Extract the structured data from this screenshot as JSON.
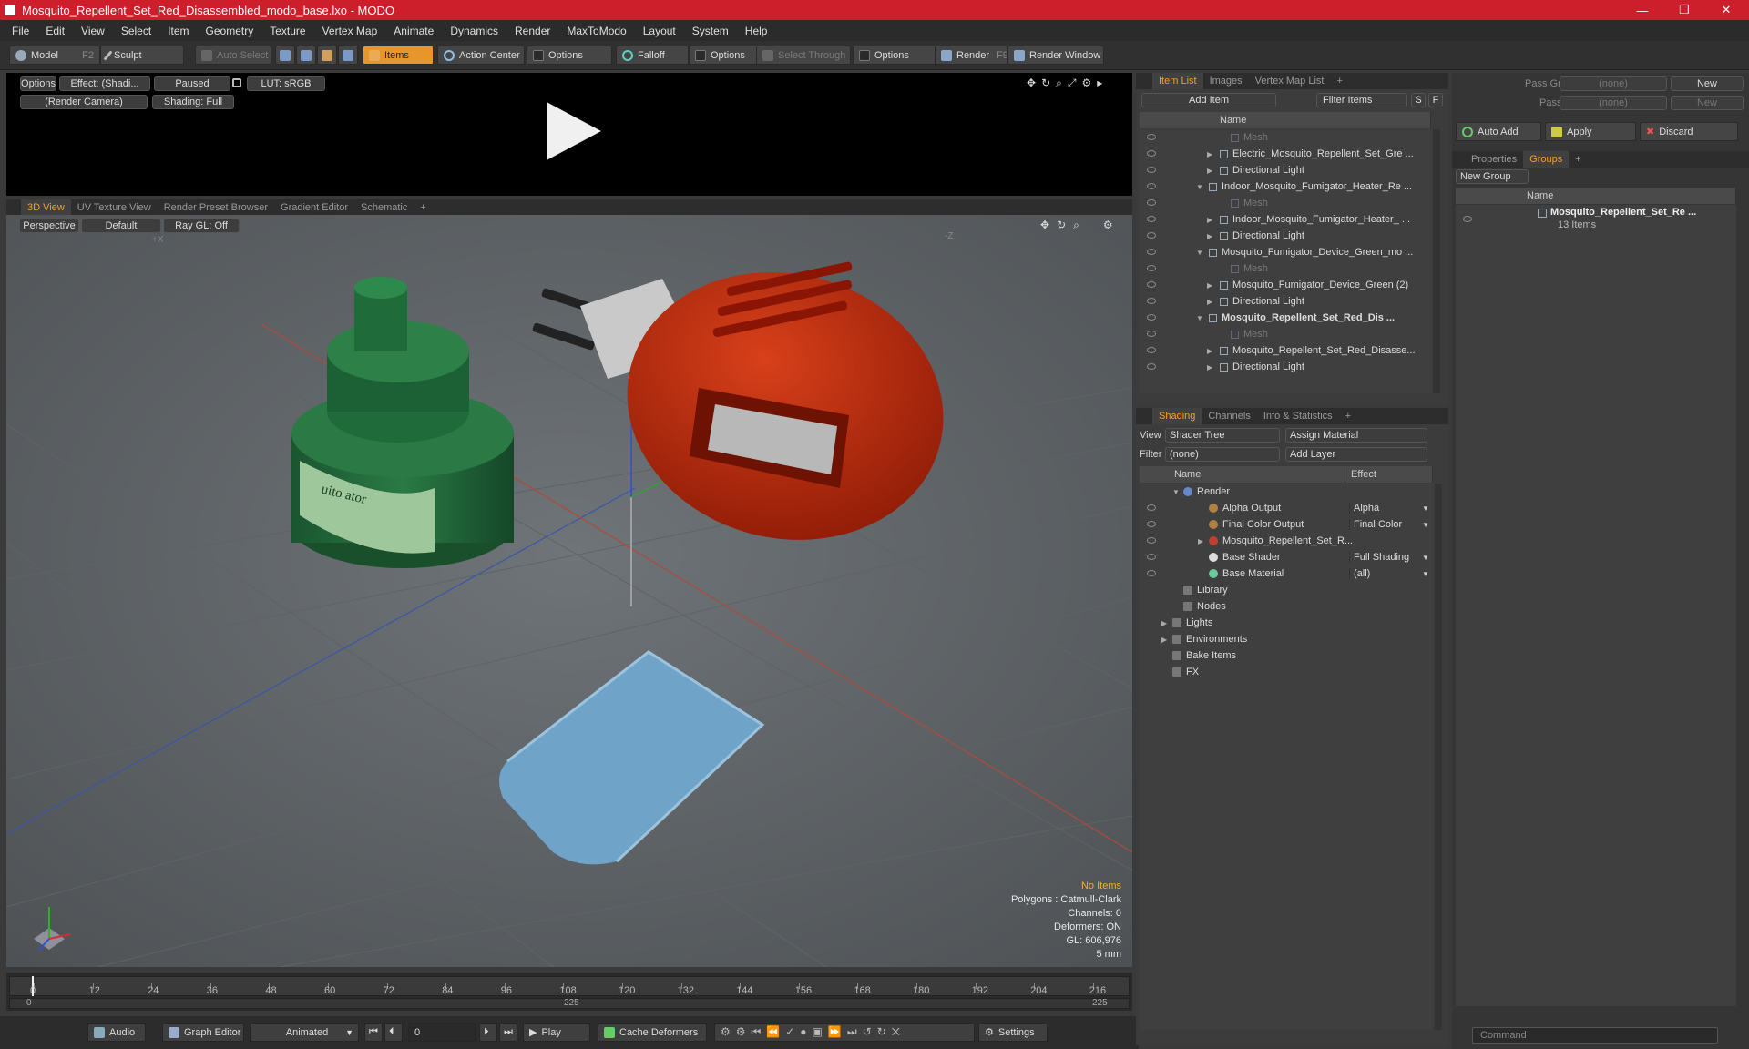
{
  "window": {
    "title": "Mosquito_Repellent_Set_Red_Disassembled_modo_base.lxo - MODO"
  },
  "menu": [
    "File",
    "Edit",
    "View",
    "Select",
    "Item",
    "Geometry",
    "Texture",
    "Vertex Map",
    "Animate",
    "Dynamics",
    "Render",
    "MaxToModo",
    "Layout",
    "System",
    "Help"
  ],
  "toolbar": {
    "model": "Model",
    "model_key": "F2",
    "sculpt": "Sculpt",
    "auto_select": "Auto Select",
    "items": "Items",
    "action_center": "Action Center",
    "options1": "Options",
    "falloff": "Falloff",
    "options2": "Options",
    "select_through": "Select Through",
    "options3": "Options",
    "render": "Render",
    "render_key": "F9",
    "render_window": "Render Window"
  },
  "render_preview": {
    "options": "Options",
    "effect": "Effect: (Shadi...",
    "paused": "Paused",
    "lut": "LUT: sRGB",
    "camera": "(Render Camera)",
    "shading": "Shading: Full"
  },
  "view_tabs": [
    "3D View",
    "UV Texture View",
    "Render Preset Browser",
    "Gradient Editor",
    "Schematic"
  ],
  "viewport": {
    "perspective": "Perspective",
    "default": "Default",
    "raygl": "Ray GL: Off",
    "status": {
      "no_items": "No Items",
      "polygons": "Polygons : Catmull-Clark",
      "channels": "Channels: 0",
      "deformers": "Deformers: ON",
      "gl": "GL: 606,976",
      "unit": "5 mm"
    },
    "label_text": "uito ator"
  },
  "timeline": {
    "ticks": [
      "0",
      "12",
      "24",
      "36",
      "48",
      "60",
      "72",
      "84",
      "96",
      "108",
      "120",
      "132",
      "144",
      "156",
      "168",
      "180",
      "192",
      "204",
      "216"
    ],
    "start": "0",
    "mid": "225",
    "end": "225"
  },
  "bottombar": {
    "audio": "Audio",
    "graph_editor": "Graph Editor",
    "animated": "Animated",
    "frame": "0",
    "play": "Play",
    "cache_deformers": "Cache Deformers",
    "settings": "Settings"
  },
  "item_panel": {
    "tabs": [
      "Item List",
      "Images",
      "Vertex Map List"
    ],
    "add_item": "Add Item",
    "filter_items": "Filter Items",
    "s": "S",
    "f": "F",
    "col_name": "Name",
    "rows": [
      {
        "label": "Mesh",
        "indent": 3,
        "dim": true,
        "bold": false
      },
      {
        "label": "Electric_Mosquito_Repellent_Set_Gre ...",
        "indent": 2,
        "dim": false,
        "bold": false
      },
      {
        "label": "Directional Light",
        "indent": 2,
        "dim": false,
        "bold": false
      },
      {
        "label": "Indoor_Mosquito_Fumigator_Heater_Re ...",
        "indent": 1,
        "dim": false,
        "bold": false
      },
      {
        "label": "Mesh",
        "indent": 3,
        "dim": true,
        "bold": false
      },
      {
        "label": "Indoor_Mosquito_Fumigator_Heater_ ...",
        "indent": 2,
        "dim": false,
        "bold": false
      },
      {
        "label": "Directional Light",
        "indent": 2,
        "dim": false,
        "bold": false
      },
      {
        "label": "Mosquito_Fumigator_Device_Green_mo ...",
        "indent": 1,
        "dim": false,
        "bold": false
      },
      {
        "label": "Mesh",
        "indent": 3,
        "dim": true,
        "bold": false
      },
      {
        "label": "Mosquito_Fumigator_Device_Green (2)",
        "indent": 2,
        "dim": false,
        "bold": false
      },
      {
        "label": "Directional Light",
        "indent": 2,
        "dim": false,
        "bold": false
      },
      {
        "label": "Mosquito_Repellent_Set_Red_Dis ...",
        "indent": 1,
        "dim": false,
        "bold": true
      },
      {
        "label": "Mesh",
        "indent": 3,
        "dim": true,
        "bold": false
      },
      {
        "label": "Mosquito_Repellent_Set_Red_Disasse...",
        "indent": 2,
        "dim": false,
        "bold": false
      },
      {
        "label": "Directional Light",
        "indent": 2,
        "dim": false,
        "bold": false
      }
    ]
  },
  "shading_panel": {
    "tabs": [
      "Shading",
      "Channels",
      "Info & Statistics"
    ],
    "view_label": "View",
    "view_value": "Shader Tree",
    "assign_material": "Assign Material",
    "filter_label": "Filter",
    "filter_value": "(none)",
    "add_layer": "Add Layer",
    "col_name": "Name",
    "col_effect": "Effect",
    "rows": [
      {
        "name": "Render",
        "effect": "",
        "indent": 0
      },
      {
        "name": "Alpha Output",
        "effect": "Alpha",
        "indent": 1
      },
      {
        "name": "Final Color Output",
        "effect": "Final Color",
        "indent": 1
      },
      {
        "name": "Mosquito_Repellent_Set_R...",
        "effect": "",
        "indent": 1
      },
      {
        "name": "Base Shader",
        "effect": "Full Shading",
        "indent": 1
      },
      {
        "name": "Base Material",
        "effect": "(all)",
        "indent": 1
      },
      {
        "name": "Library",
        "effect": "",
        "indent": 0
      },
      {
        "name": "Nodes",
        "effect": "",
        "indent": 0
      },
      {
        "name": "Lights",
        "effect": "",
        "indent": -1
      },
      {
        "name": "Environments",
        "effect": "",
        "indent": -1
      },
      {
        "name": "Bake Items",
        "effect": "",
        "indent": -1
      },
      {
        "name": "FX",
        "effect": "",
        "indent": -1
      }
    ]
  },
  "groups_panel": {
    "pass_groups": "Pass Groups",
    "pass_groups_val": "(none)",
    "new1": "New",
    "passes": "Passes",
    "passes_val": "(none)",
    "new2": "New",
    "auto_add": "Auto Add",
    "apply": "Apply",
    "discard": "Discard",
    "tabs": [
      "Properties",
      "Groups"
    ],
    "new_group": "New Group",
    "col_name": "Name",
    "group_name": "Mosquito_Repellent_Set_Re ...",
    "group_count": "13 Items",
    "command_placeholder": "Command"
  },
  "colors": {
    "title_red": "#cc1f2b",
    "accent_orange": "#f0a030",
    "device_red": "#c42a0c",
    "bottle_green": "#1f6b3a",
    "pad_blue": "#6fa3c8"
  }
}
